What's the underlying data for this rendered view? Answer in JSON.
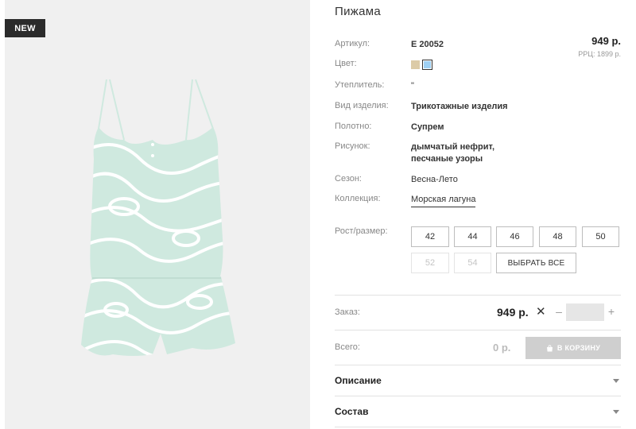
{
  "badge": "NEW",
  "product": {
    "title": "Пижама",
    "price": "949 р.",
    "rrp": "РРЦ: 1899 р."
  },
  "properties": {
    "article": {
      "label": "Артикул:",
      "value": "Е 20052"
    },
    "color": {
      "label": "Цвет:",
      "swatches": [
        "#dccba7",
        "#9ed0f4"
      ]
    },
    "insulation": {
      "label": "Утеплитель:",
      "value": "\""
    },
    "kind": {
      "label": "Вид изделия:",
      "value": "Трикотажные изделия"
    },
    "fabric": {
      "label": "Полотно:",
      "value": "Супрем"
    },
    "pattern": {
      "label": "Рисунок:",
      "line1": "дымчатый нефрит,",
      "line2": "песчаные узоры"
    },
    "season": {
      "label": "Сезон:",
      "value": "Весна-Лето"
    },
    "collection": {
      "label": "Коллекция:",
      "value": "Морская лагуна"
    }
  },
  "sizes": {
    "label": "Рост/размер:",
    "available": [
      "42",
      "44",
      "46",
      "48",
      "50"
    ],
    "unavailable": [
      "52",
      "54"
    ],
    "select_all": "ВЫБРАТЬ ВСЕ"
  },
  "order": {
    "label": "Заказ:",
    "price": "949 р.",
    "times": "✕",
    "minus": "–",
    "plus": "+",
    "quantity": ""
  },
  "total": {
    "label": "Всего:",
    "value": "0 р.",
    "cart_button": "В КОРЗИНУ"
  },
  "accordions": {
    "description": "Описание",
    "composition": "Состав"
  },
  "colors": {
    "image_bg": "#f0f0f0",
    "garment": "#cfe9df",
    "badge_bg": "#2b2b2b",
    "cart_disabled": "#cfcfcf"
  }
}
